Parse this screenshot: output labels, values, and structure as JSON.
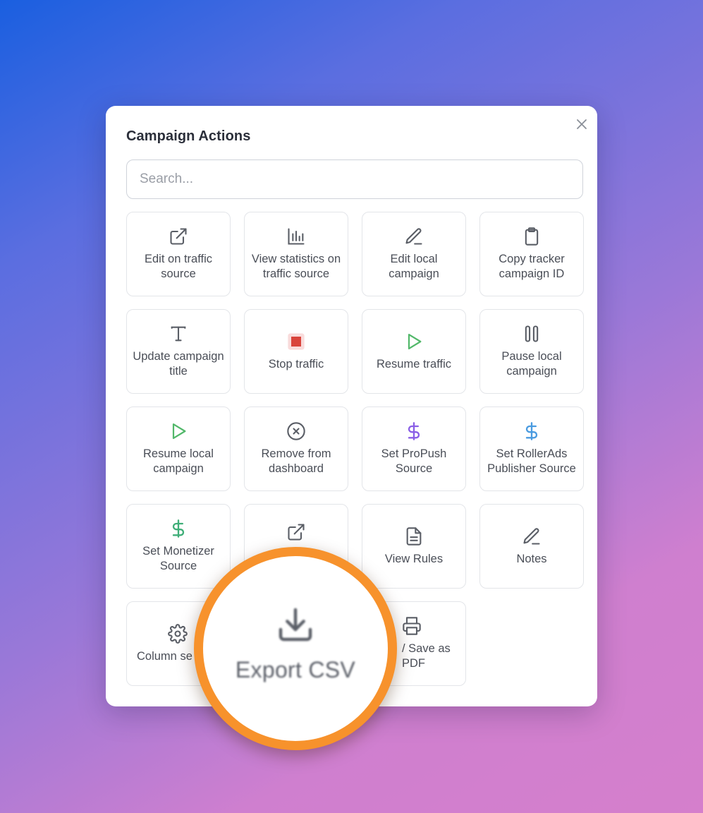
{
  "modal": {
    "title": "Campaign Actions",
    "search_placeholder": "Search..."
  },
  "actions": [
    {
      "label": "Edit on traffic source",
      "icon": "external-link-icon"
    },
    {
      "label": "View statistics on traffic source",
      "icon": "bar-chart-icon"
    },
    {
      "label": "Edit local campaign",
      "icon": "pencil-icon"
    },
    {
      "label": "Copy tracker campaign ID",
      "icon": "clipboard-icon"
    },
    {
      "label": "Update campaign title",
      "icon": "text-icon"
    },
    {
      "label": "Stop traffic",
      "icon": "stop-icon"
    },
    {
      "label": "Resume traffic",
      "icon": "play-icon"
    },
    {
      "label": "Pause local campaign",
      "icon": "pause-icon"
    },
    {
      "label": "Resume local campaign",
      "icon": "play-icon"
    },
    {
      "label": "Remove from dashboard",
      "icon": "x-circle-icon"
    },
    {
      "label": "Set ProPush Source",
      "icon": "dollar-icon"
    },
    {
      "label": "Set RollerAds Publisher Source",
      "icon": "dollar-icon"
    },
    {
      "label": "Set Monetizer Source",
      "icon": "dollar-icon"
    },
    {
      "label": "",
      "icon": "external-link-icon"
    },
    {
      "label": "View Rules",
      "icon": "document-icon"
    },
    {
      "label": "Notes",
      "icon": "pencil-icon"
    },
    {
      "label": "Column se",
      "icon": "gear-icon"
    },
    {
      "label": "",
      "icon": "download-icon"
    },
    {
      "label": "/ Save as PDF",
      "icon": "printer-icon"
    }
  ],
  "magnifier": {
    "label": "Export CSV",
    "icon": "download-icon"
  },
  "colors": {
    "accent_orange": "#f7922c",
    "play_green": "#52b86a",
    "stop_red": "#d9443c",
    "dollar_purple": "#8a5fe6",
    "dollar_blue": "#4a9be0",
    "dollar_green": "#3fae78"
  }
}
